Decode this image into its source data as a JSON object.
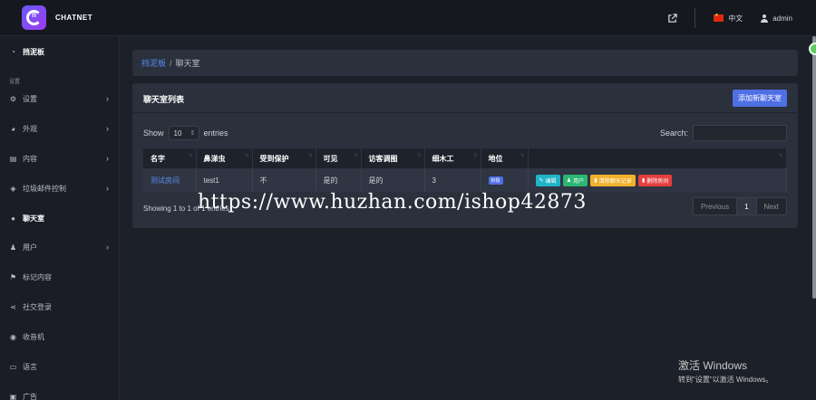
{
  "brand": {
    "name": "CHATNET"
  },
  "topbar": {
    "language": "中文",
    "username": "admin"
  },
  "sidebar": {
    "section_label": "设置",
    "items": [
      {
        "label": "挡泥板",
        "icon": "dashboard-icon",
        "bold": true,
        "chevron": false
      },
      {
        "label": "设置",
        "icon": "gear-icon",
        "bold": false,
        "chevron": true
      },
      {
        "label": "外观",
        "icon": "palette-icon",
        "bold": false,
        "chevron": true
      },
      {
        "label": "内容",
        "icon": "list-icon",
        "bold": false,
        "chevron": true
      },
      {
        "label": "垃圾邮件控制",
        "icon": "shield-icon",
        "bold": false,
        "chevron": true
      },
      {
        "label": "聊天室",
        "icon": "chat-icon",
        "bold": true,
        "chevron": false
      },
      {
        "label": "用户",
        "icon": "users-icon",
        "bold": false,
        "chevron": true
      },
      {
        "label": "标记内容",
        "icon": "flag-icon",
        "bold": false,
        "chevron": false
      },
      {
        "label": "社交登录",
        "icon": "share-icon",
        "bold": false,
        "chevron": false
      },
      {
        "label": "收音机",
        "icon": "radio-icon",
        "bold": false,
        "chevron": false
      },
      {
        "label": "语言",
        "icon": "keyboard-icon",
        "bold": false,
        "chevron": false
      },
      {
        "label": "广告",
        "icon": "ad-icon",
        "bold": false,
        "chevron": false
      }
    ]
  },
  "breadcrumb": {
    "home": "挡泥板",
    "separator": "/",
    "current": "聊天室"
  },
  "card": {
    "title": "聊天室列表",
    "add_button": "添加新聊天室",
    "show_label": "Show",
    "entries_value": "10",
    "entries_label": "entries",
    "search_label": "Search:"
  },
  "table": {
    "headers": [
      "名字",
      "鼻涕虫",
      "受到保护",
      "可见",
      "访客调图",
      "细木工",
      "地位",
      ""
    ],
    "rows": [
      {
        "name": "测试房间",
        "slug": "test1",
        "protected": "不",
        "visible": "是的",
        "guest": "是的",
        "joiner": "3",
        "status": "积极",
        "actions": {
          "edit": "编辑",
          "users": "用户",
          "clear": "清除聊天记录",
          "delete": "删除房间"
        }
      }
    ]
  },
  "footer": {
    "info": "Showing 1 to 1 of 1 entries",
    "prev": "Previous",
    "page": "1",
    "next": "Next"
  },
  "watermark": "https://www.huzhan.com/ishop42873",
  "windows": {
    "title": "激活 Windows",
    "subtitle": "转到\"设置\"以激活 Windows。"
  }
}
